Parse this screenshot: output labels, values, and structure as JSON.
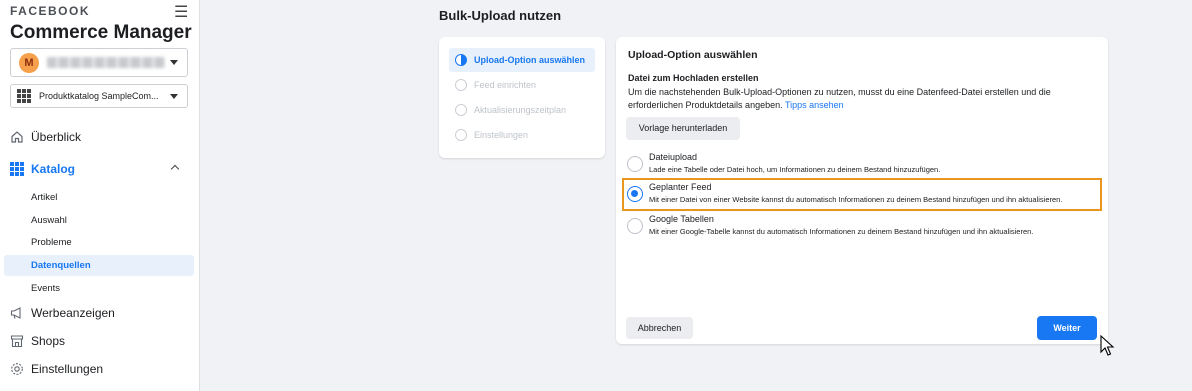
{
  "sidebar": {
    "brand": "FACEBOOK",
    "app_title": "Commerce Manager",
    "business_avatar_letter": "M",
    "catalog_name": "Produktkatalog SampleCom...",
    "nav": {
      "overview": "Überblick",
      "catalog": "Katalog",
      "ads": "Werbeanzeigen",
      "shops": "Shops",
      "settings": "Einstellungen"
    },
    "catalog_sub": [
      "Artikel",
      "Auswahl",
      "Probleme",
      "Datenquellen",
      "Events"
    ],
    "active_sub": "Datenquellen"
  },
  "main": {
    "page_title": "Bulk-Upload nutzen",
    "steps": [
      {
        "label": "Upload-Option auswählen",
        "active": true
      },
      {
        "label": "Feed einrichten",
        "active": false
      },
      {
        "label": "Aktualisierungszeitplan",
        "active": false
      },
      {
        "label": "Einstellungen",
        "active": false
      }
    ],
    "card": {
      "title": "Upload-Option auswählen",
      "section_title": "Datei zum Hochladen erstellen",
      "description": "Um die nachstehenden Bulk-Upload-Optionen zu nutzen, musst du eine Datenfeed-Datei erstellen und die erforderlichen Produktdetails angeben.",
      "tips_link": "Tipps ansehen",
      "template_button": "Vorlage herunterladen",
      "options": [
        {
          "label": "Dateiupload",
          "desc": "Lade eine Tabelle oder Datei hoch, um Informationen zu deinem Bestand hinzuzufügen.",
          "checked": false
        },
        {
          "label": "Geplanter Feed",
          "desc": "Mit einer Datei von einer Website kannst du automatisch Informationen zu deinem Bestand hinzufügen und ihn aktualisieren.",
          "checked": true
        },
        {
          "label": "Google Tabellen",
          "desc": "Mit einer Google-Tabelle kannst du automatisch Informationen zu deinem Bestand hinzufügen und ihn aktualisieren.",
          "checked": false
        }
      ],
      "cancel_button": "Abbrechen",
      "next_button": "Weiter"
    }
  },
  "colors": {
    "accent": "#1877f2",
    "highlight": "#e8961e",
    "background": "#f0f2f5"
  }
}
